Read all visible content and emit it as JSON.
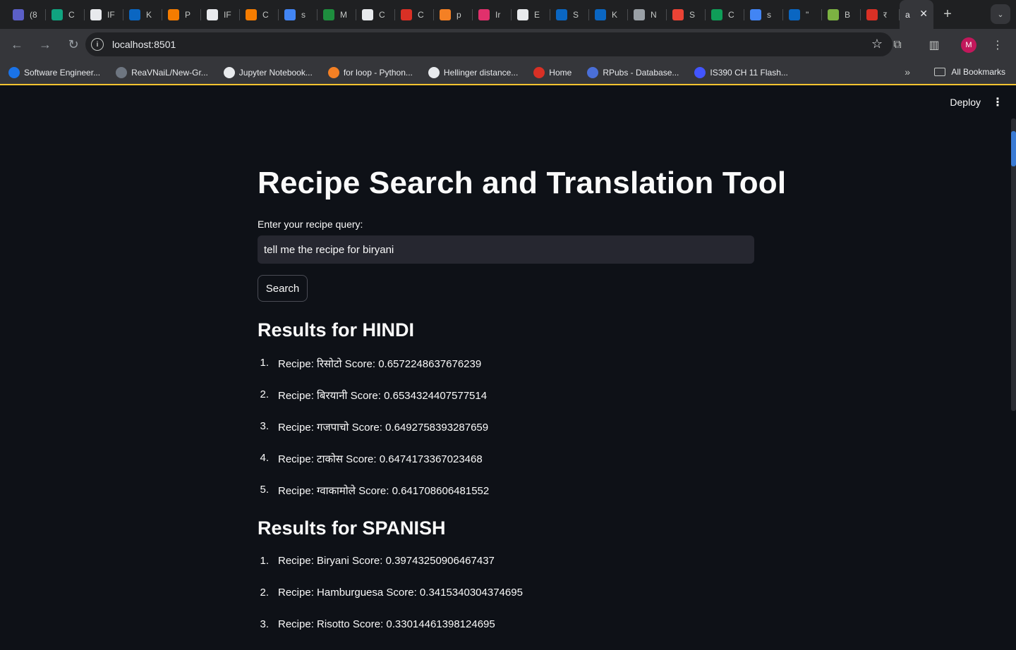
{
  "browser": {
    "tabs": [
      {
        "icon": "teams-icon",
        "label": "(8",
        "color": "#5b5fc7"
      },
      {
        "icon": "chatgpt-icon",
        "label": "C",
        "color": "#10a37f"
      },
      {
        "icon": "github-icon",
        "label": "IF",
        "color": "#e8eaed"
      },
      {
        "icon": "linkedin-icon",
        "label": "K",
        "color": "#0a66c2"
      },
      {
        "icon": "infinity-icon",
        "label": "P",
        "color": "#f57c00"
      },
      {
        "icon": "github-icon",
        "label": "IF",
        "color": "#e8eaed"
      },
      {
        "icon": "infinity-icon",
        "label": "C",
        "color": "#f57c00"
      },
      {
        "icon": "google-icon",
        "label": "s",
        "color": "#4285f4"
      },
      {
        "icon": "pin-icon",
        "label": "M",
        "color": "#1e8e3e"
      },
      {
        "icon": "anthropic-icon",
        "label": "C",
        "color": "#e8eaed"
      },
      {
        "icon": "sun-icon",
        "label": "C",
        "color": "#d93025"
      },
      {
        "icon": "stackoverflow-icon",
        "label": "p",
        "color": "#f48024"
      },
      {
        "icon": "instagram-icon",
        "label": "Ir",
        "color": "#e1306c"
      },
      {
        "icon": "notion-icon",
        "label": "E",
        "color": "#e8eaed"
      },
      {
        "icon": "linkedin-icon",
        "label": "S",
        "color": "#0a66c2"
      },
      {
        "icon": "linkedin-icon",
        "label": "K",
        "color": "#0a66c2"
      },
      {
        "icon": "chrome-icon",
        "label": "N",
        "color": "#9aa0a6"
      },
      {
        "icon": "gmail-icon",
        "label": "S",
        "color": "#ea4335"
      },
      {
        "icon": "sheets-icon",
        "label": "C",
        "color": "#0f9d58"
      },
      {
        "icon": "google-icon",
        "label": "s",
        "color": "#4285f4"
      },
      {
        "icon": "linkedin-icon",
        "label": "\"",
        "color": "#0a66c2"
      },
      {
        "icon": "leaf-icon",
        "label": "B",
        "color": "#7cb342"
      },
      {
        "icon": "c-icon",
        "label": "र",
        "color": "#d93025"
      }
    ],
    "active_tab": {
      "label": "a"
    },
    "url": "localhost:8501",
    "bookmarks": [
      {
        "label": "Software Engineer...",
        "color": "#1a73e8"
      },
      {
        "label": "ReaVNaiL/New-Gr...",
        "color": "#6e7681"
      },
      {
        "label": "Jupyter Notebook...",
        "color": "#e8eaed"
      },
      {
        "label": "for loop - Python...",
        "color": "#f48024"
      },
      {
        "label": "Hellinger distance...",
        "color": "#e8eaed"
      },
      {
        "label": "Home",
        "color": "#d93025"
      },
      {
        "label": "RPubs - Database...",
        "color": "#4a6fd8"
      },
      {
        "label": "IS390 CH 11 Flash...",
        "color": "#4255ff"
      }
    ],
    "all_bookmarks": "All Bookmarks",
    "avatar_letter": "M"
  },
  "app": {
    "deploy_label": "Deploy",
    "title": "Recipe Search and Translation Tool",
    "query_label": "Enter your recipe query:",
    "query_value": "tell me the recipe for biryani",
    "search_label": "Search",
    "sections": [
      {
        "heading": "Results for HINDI",
        "results": [
          {
            "num": "1.",
            "text": "Recipe: रिसोटो Score: 0.6572248637676239"
          },
          {
            "num": "2.",
            "text": "Recipe: बिरयानी Score: 0.6534324407577514"
          },
          {
            "num": "3.",
            "text": "Recipe: गजपाचो Score: 0.6492758393287659"
          },
          {
            "num": "4.",
            "text": "Recipe: टाकोस Score: 0.6474173367023468"
          },
          {
            "num": "5.",
            "text": "Recipe: ग्वाकामोले Score: 0.641708606481552"
          }
        ]
      },
      {
        "heading": "Results for SPANISH",
        "results": [
          {
            "num": "1.",
            "text": "Recipe: Biryani Score: 0.39743250906467437"
          },
          {
            "num": "2.",
            "text": "Recipe: Hamburguesa Score: 0.3415340304374695"
          },
          {
            "num": "3.",
            "text": "Recipe: Risotto Score: 0.33014461398124695"
          }
        ]
      }
    ]
  }
}
